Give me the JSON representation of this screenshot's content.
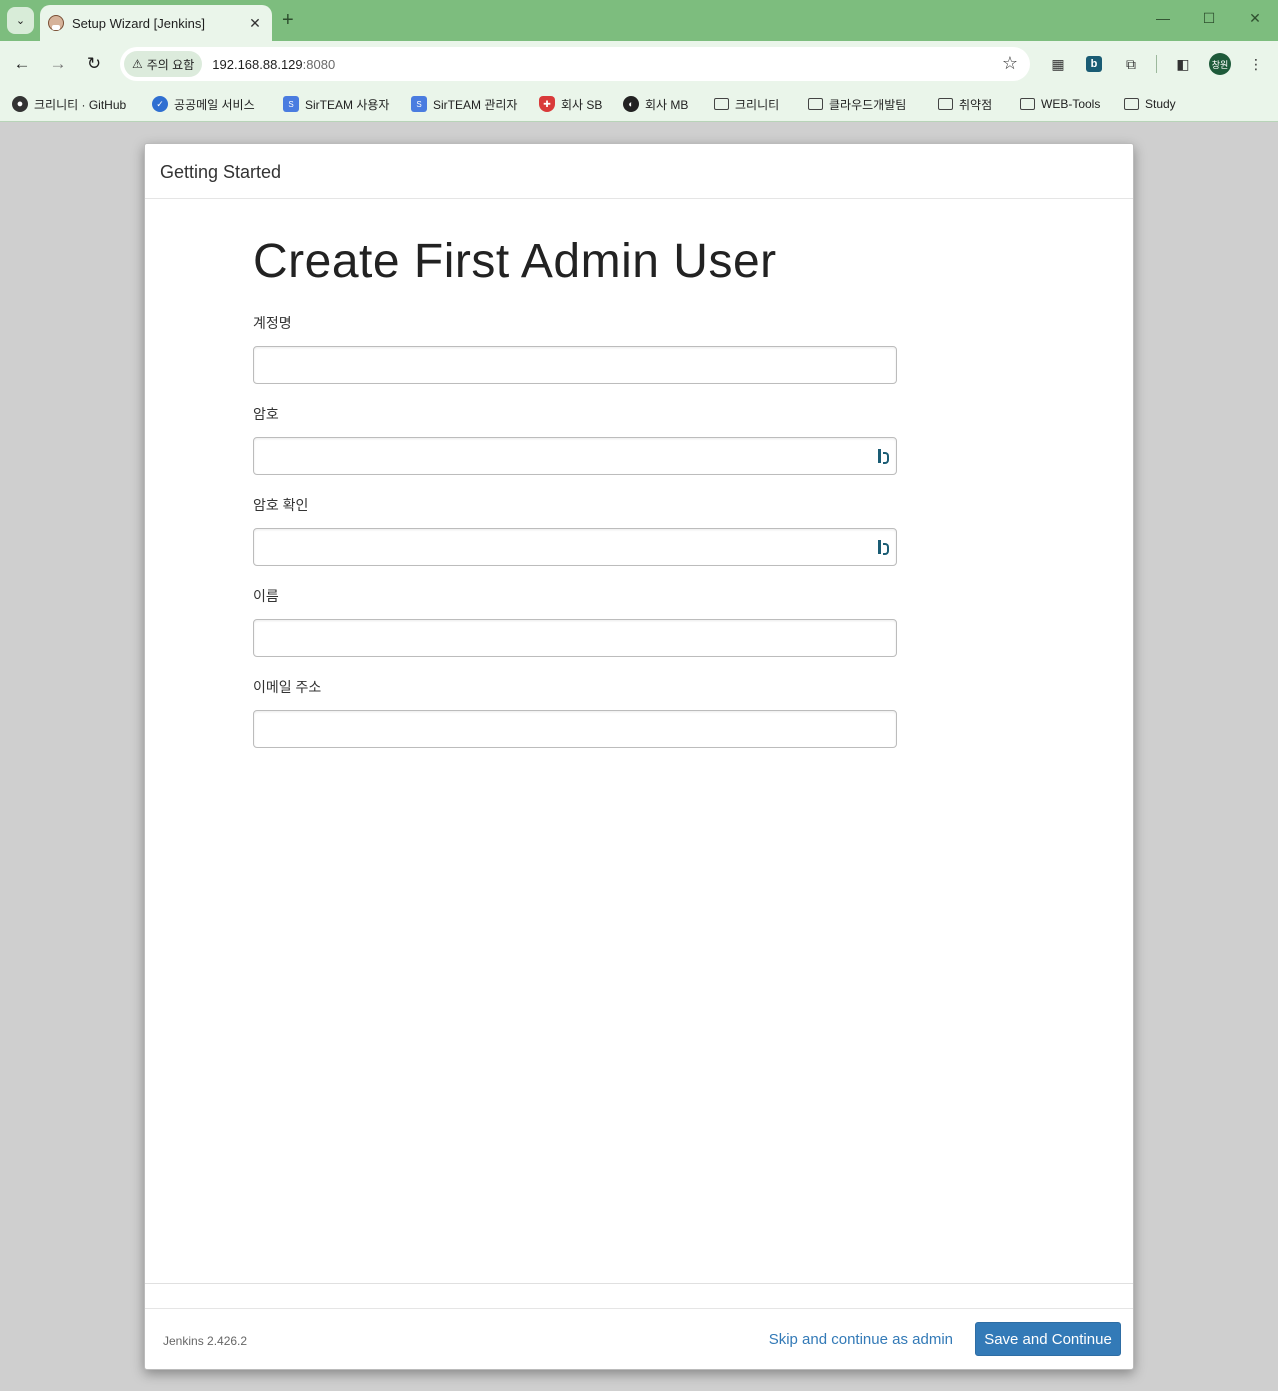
{
  "browser": {
    "tab": {
      "title": "Setup Wizard [Jenkins]",
      "close": "✕"
    },
    "new_tab": "+",
    "window_controls": {
      "minimize": "—",
      "maximize": "☐",
      "close": "✕"
    },
    "address": {
      "security_chip": "주의 요함",
      "host": "192.168.88.129",
      "port": ":8080"
    },
    "profile_label": "창원",
    "bookmarks": [
      {
        "label": "크리니티 · GitHub",
        "icon": "github-icon"
      },
      {
        "label": "공공메일 서비스",
        "icon": "verified-check-icon"
      },
      {
        "label": "SirTEAM 사용자",
        "icon": "sirteam-icon"
      },
      {
        "label": "SirTEAM 관리자",
        "icon": "sirteam-icon"
      },
      {
        "label": "회사 SB",
        "icon": "shield-icon"
      },
      {
        "label": "회사 MB",
        "icon": "globe-icon"
      },
      {
        "label": "크리니티",
        "icon": "folder-icon"
      },
      {
        "label": "클라우드개발팀",
        "icon": "folder-icon"
      },
      {
        "label": "취약점",
        "icon": "folder-icon"
      },
      {
        "label": "WEB-Tools",
        "icon": "folder-icon"
      },
      {
        "label": "Study",
        "icon": "folder-icon"
      }
    ]
  },
  "wizard": {
    "header": "Getting Started",
    "title": "Create First Admin User",
    "fields": {
      "username": {
        "label": "계정명",
        "value": ""
      },
      "password": {
        "label": "암호",
        "value": ""
      },
      "confirm_password": {
        "label": "암호 확인",
        "value": ""
      },
      "fullname": {
        "label": "이름",
        "value": ""
      },
      "email": {
        "label": "이메일 주소",
        "value": ""
      }
    },
    "footer": {
      "version": "Jenkins 2.426.2",
      "skip_label": "Skip and continue as admin",
      "save_label": "Save and Continue"
    }
  },
  "colors": {
    "browser_frame": "#7dbd7e",
    "toolbar": "#eaf5ea",
    "primary_button": "#337ab7",
    "link": "#337ab7"
  }
}
